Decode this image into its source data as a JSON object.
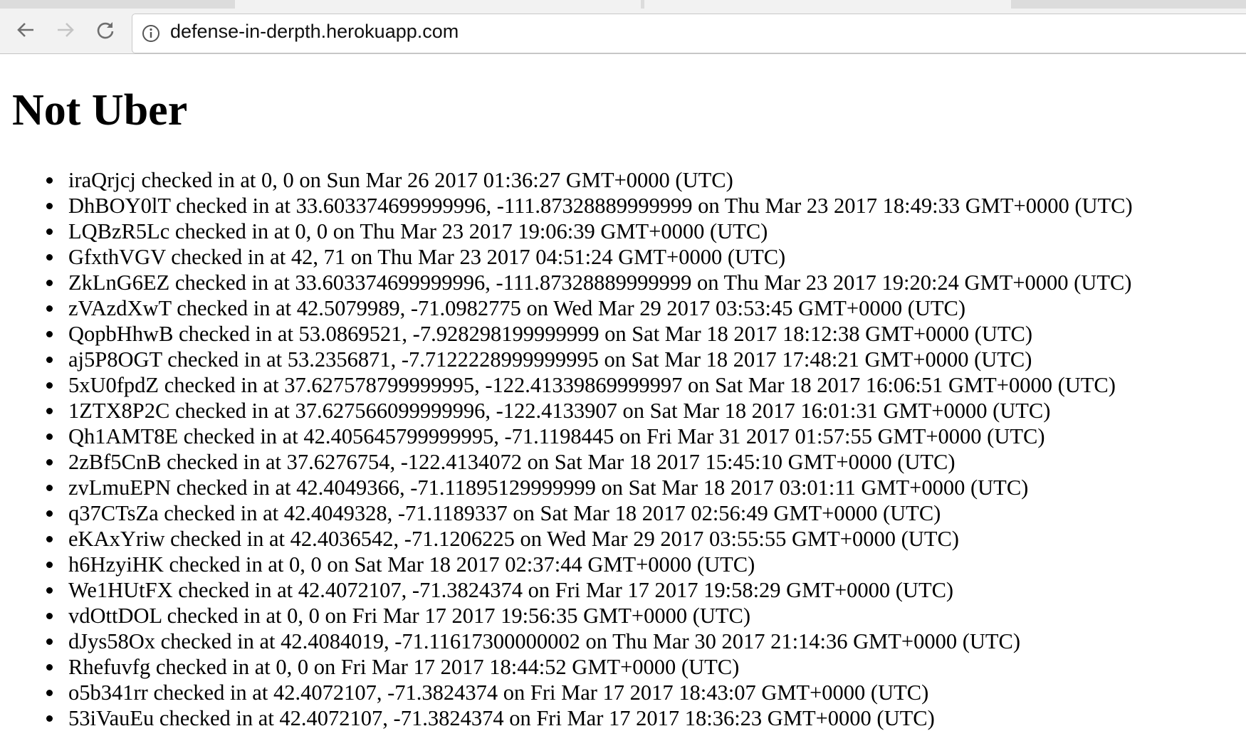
{
  "browser": {
    "url": "defense-in-derpth.herokuapp.com",
    "back_icon": "arrow-left-icon",
    "forward_icon": "arrow-right-icon",
    "reload_icon": "reload-icon",
    "info_icon": "info-circle-icon"
  },
  "page": {
    "title": "Not Uber",
    "checkins": [
      "iraQrjcj checked in at 0, 0 on Sun Mar 26 2017 01:36:27 GMT+0000 (UTC)",
      "DhBOY0lT checked in at 33.603374699999996, -111.87328889999999 on Thu Mar 23 2017 18:49:33 GMT+0000 (UTC)",
      "LQBzR5Lc checked in at 0, 0 on Thu Mar 23 2017 19:06:39 GMT+0000 (UTC)",
      "GfxthVGV checked in at 42, 71 on Thu Mar 23 2017 04:51:24 GMT+0000 (UTC)",
      "ZkLnG6EZ checked in at 33.603374699999996, -111.87328889999999 on Thu Mar 23 2017 19:20:24 GMT+0000 (UTC)",
      "zVAzdXwT checked in at 42.5079989, -71.0982775 on Wed Mar 29 2017 03:53:45 GMT+0000 (UTC)",
      "QopbHhwB checked in at 53.0869521, -7.928298199999999 on Sat Mar 18 2017 18:12:38 GMT+0000 (UTC)",
      "aj5P8OGT checked in at 53.2356871, -7.7122228999999995 on Sat Mar 18 2017 17:48:21 GMT+0000 (UTC)",
      "5xU0fpdZ checked in at 37.627578799999995, -122.41339869999997 on Sat Mar 18 2017 16:06:51 GMT+0000 (UTC)",
      "1ZTX8P2C checked in at 37.627566099999996, -122.4133907 on Sat Mar 18 2017 16:01:31 GMT+0000 (UTC)",
      "Qh1AMT8E checked in at 42.405645799999995, -71.1198445 on Fri Mar 31 2017 01:57:55 GMT+0000 (UTC)",
      "2zBf5CnB checked in at 37.6276754, -122.4134072 on Sat Mar 18 2017 15:45:10 GMT+0000 (UTC)",
      "zvLmuEPN checked in at 42.4049366, -71.11895129999999 on Sat Mar 18 2017 03:01:11 GMT+0000 (UTC)",
      "q37CTsZa checked in at 42.4049328, -71.1189337 on Sat Mar 18 2017 02:56:49 GMT+0000 (UTC)",
      "eKAxYriw checked in at 42.4036542, -71.1206225 on Wed Mar 29 2017 03:55:55 GMT+0000 (UTC)",
      "h6HzyiHK checked in at 0, 0 on Sat Mar 18 2017 02:37:44 GMT+0000 (UTC)",
      "We1HUtFX checked in at 42.4072107, -71.3824374 on Fri Mar 17 2017 19:58:29 GMT+0000 (UTC)",
      "vdOttDOL checked in at 0, 0 on Fri Mar 17 2017 19:56:35 GMT+0000 (UTC)",
      "dJys58Ox checked in at 42.4084019, -71.11617300000002 on Thu Mar 30 2017 21:14:36 GMT+0000 (UTC)",
      "Rhefuvfg checked in at 0, 0 on Fri Mar 17 2017 18:44:52 GMT+0000 (UTC)",
      "o5b341rr checked in at 42.4072107, -71.3824374 on Fri Mar 17 2017 18:43:07 GMT+0000 (UTC)",
      "53iVauEu checked in at 42.4072107, -71.3824374 on Fri Mar 17 2017 18:36:23 GMT+0000 (UTC)"
    ]
  }
}
